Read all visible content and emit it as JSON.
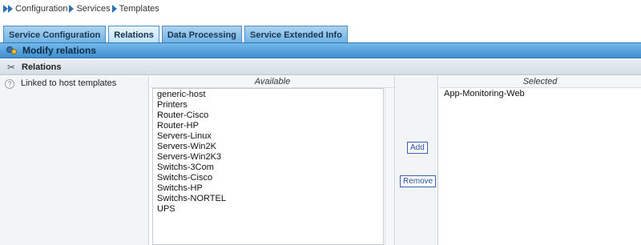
{
  "breadcrumb": {
    "items": [
      "Configuration",
      "Services",
      "Templates"
    ]
  },
  "tabs": [
    {
      "label": "Service Configuration",
      "active": false
    },
    {
      "label": "Relations",
      "active": true
    },
    {
      "label": "Data Processing",
      "active": false
    },
    {
      "label": "Service Extended Info",
      "active": false
    }
  ],
  "header": {
    "title": "Modify relations",
    "icon": "users-icon"
  },
  "section": {
    "title": "Relations",
    "icon": "link-icon"
  },
  "field": {
    "label": "Linked to host templates",
    "help_icon": "help-icon"
  },
  "available": {
    "heading": "Available",
    "items": [
      "generic-host",
      "Printers",
      "Router-Cisco",
      "Router-HP",
      "Servers-Linux",
      "Servers-Win2K",
      "Servers-Win2K3",
      "Switchs-3Com",
      "Switchs-Cisco",
      "Switchs-HP",
      "Switchs-NORTEL",
      "UPS"
    ]
  },
  "actions": {
    "add_label": "Add",
    "remove_label": "Remove"
  },
  "selected": {
    "heading": "Selected",
    "items": [
      "App-Monitoring-Web"
    ]
  },
  "colors": {
    "accent": "#3e8fd0",
    "tab": "#6fb1e2",
    "link_button": "#2a4fa0"
  }
}
